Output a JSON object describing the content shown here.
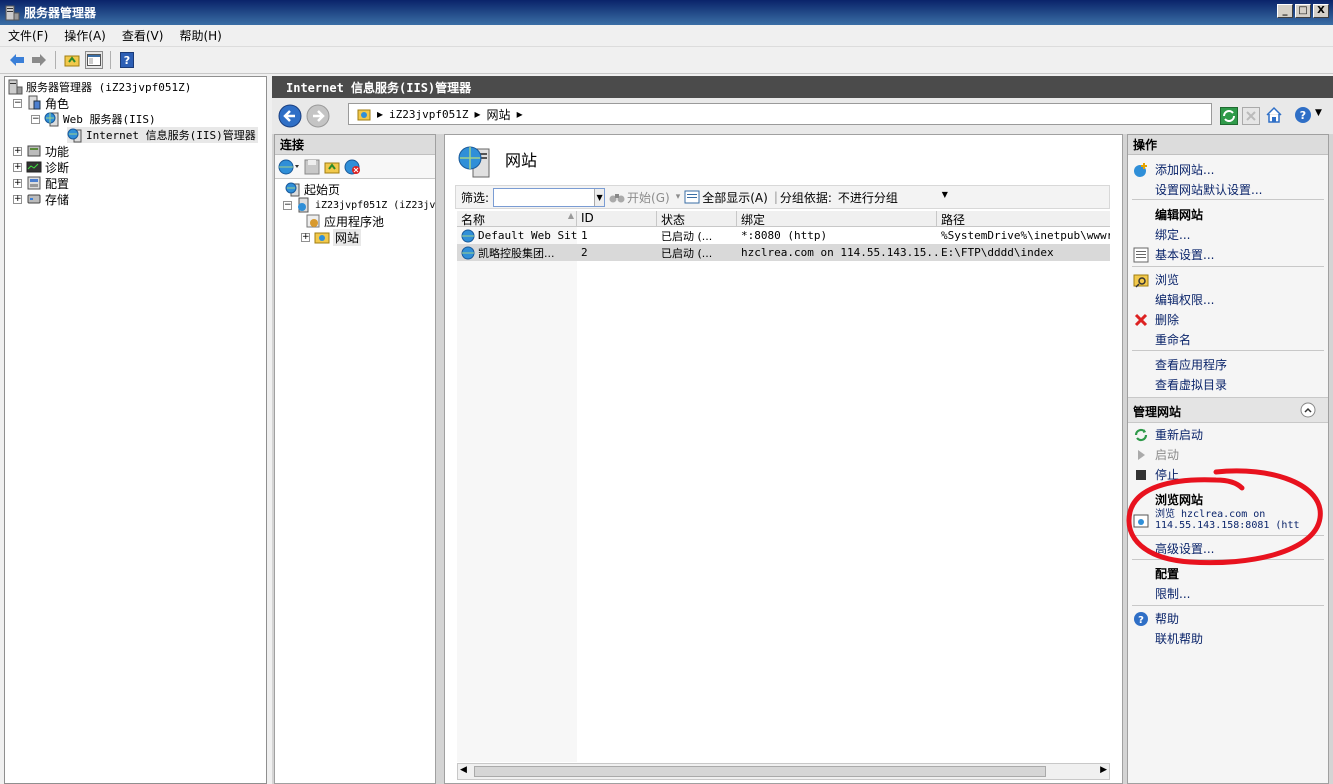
{
  "window": {
    "title": "服务器管理器",
    "min": "_",
    "max": "□",
    "close": "X"
  },
  "menu": [
    "文件(F)",
    "操作(A)",
    "查看(V)",
    "帮助(H)"
  ],
  "tree": {
    "root": "服务器管理器 (iZ23jvpf051Z)",
    "roles": "角色",
    "web": "Web 服务器(IIS)",
    "iis": "Internet 信息服务(IIS)管理器",
    "features": "功能",
    "diag": "诊断",
    "config": "配置",
    "storage": "存储"
  },
  "iis": {
    "header": "Internet 信息服务(IIS)管理器",
    "breadcrumb": [
      "iZ23jvpf051Z",
      "网站"
    ],
    "connections_title": "连接",
    "conn_tree": {
      "start": "起始页",
      "server": "iZ23jvpf051Z (iZ23jv",
      "apppool": "应用程序池",
      "sites": "网站"
    },
    "page_title": "网站",
    "filter": {
      "label": "筛选:",
      "go": "开始(G)",
      "showall": "全部显示(A)",
      "groupby": "分组依据:",
      "groupval": "不进行分组"
    },
    "columns": [
      "名称",
      "ID",
      "状态",
      "绑定",
      "路径"
    ],
    "rows": [
      [
        "Default Web Site",
        "1",
        "已启动 (...",
        "*:8080 (http)",
        "%SystemDrive%\\inetpub\\wwwroo"
      ],
      [
        "凯略控股集团...",
        "2",
        "已启动 (...",
        "hzclrea.com on 114.55.143.15...",
        "E:\\FTP\\dddd\\index"
      ]
    ]
  },
  "actions": {
    "title": "操作",
    "add_site": "添加网站...",
    "site_defaults": "设置网站默认设置...",
    "edit_site": "编辑网站",
    "bindings": "绑定...",
    "basic": "基本设置...",
    "explore": "浏览",
    "edit_perm": "编辑权限...",
    "delete": "删除",
    "rename": "重命名",
    "view_apps": "查看应用程序",
    "view_vdirs": "查看虚拟目录",
    "manage_site": "管理网站",
    "restart": "重新启动",
    "start": "启动",
    "stop": "停止",
    "browse_site": "浏览网站",
    "browse_link_1": "浏览 hzclrea.com on",
    "browse_link_2": "114.55.143.158:8081 (htt",
    "advanced": "高级设置...",
    "configure": "配置",
    "limits": "限制...",
    "help": "帮助",
    "online_help": "联机帮助"
  },
  "colors": {
    "accent": "#0a246a",
    "annotation": "#e8121e"
  }
}
